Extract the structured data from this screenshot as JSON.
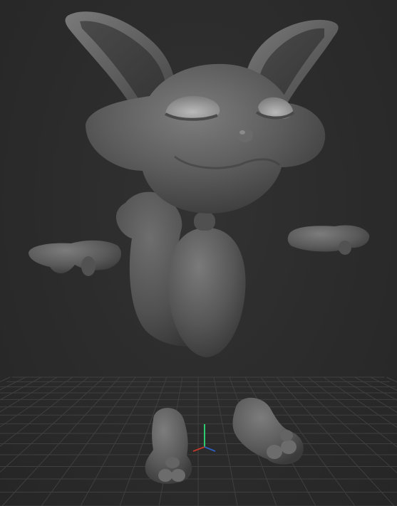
{
  "viewport": {
    "background": "#2b2b2b",
    "grid_color": "#3f3f3f",
    "model_color": "#5a5a5a"
  },
  "gizmo": {
    "axes": [
      {
        "name": "x",
        "color": "#c0392b"
      },
      {
        "name": "y",
        "color": "#27ae60"
      },
      {
        "name": "z",
        "color": "#2e5fbf"
      }
    ]
  },
  "model": {
    "parts": [
      "head",
      "ear-left",
      "ear-right",
      "body",
      "tail",
      "hand-left",
      "hand-right",
      "foot-left",
      "foot-right"
    ]
  }
}
